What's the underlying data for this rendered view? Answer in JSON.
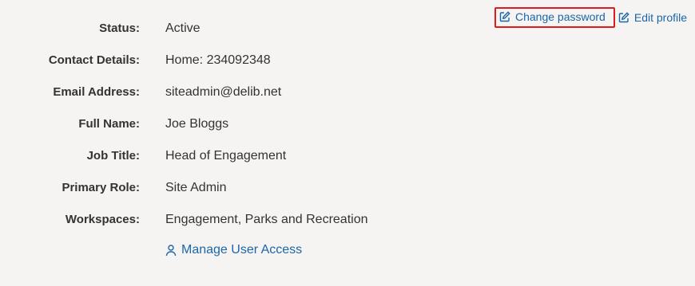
{
  "actions": {
    "change_password": "Change password",
    "edit_profile": "Edit profile"
  },
  "details": [
    {
      "label": "Status:",
      "value": "Active"
    },
    {
      "label": "Contact Details:",
      "value": "Home: 234092348"
    },
    {
      "label": "Email Address:",
      "value": "siteadmin@delib.net"
    },
    {
      "label": "Full Name:",
      "value": "Joe Bloggs"
    },
    {
      "label": "Job Title:",
      "value": "Head of Engagement"
    },
    {
      "label": "Primary Role:",
      "value": "Site Admin"
    },
    {
      "label": "Workspaces:",
      "value": "Engagement, Parks and Recreation"
    }
  ],
  "manage_access": {
    "label": "Manage User Access",
    "icon": "user-icon"
  },
  "icons": {
    "change_password": "edit-icon",
    "edit_profile": "edit-icon"
  },
  "colors": {
    "background": "#f5f4f2",
    "link": "#1a66a8",
    "highlight": "#e01b1b",
    "text": "#333333"
  }
}
